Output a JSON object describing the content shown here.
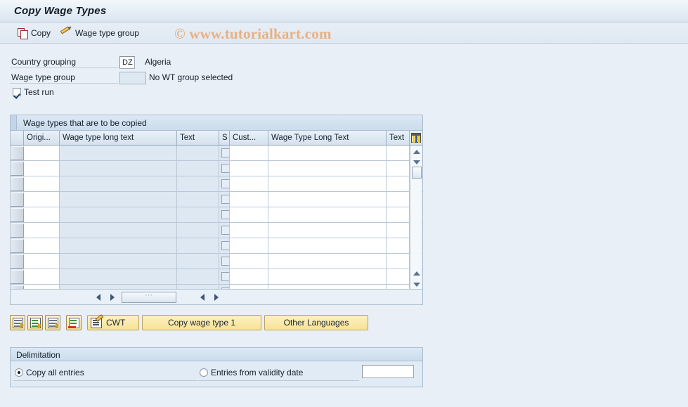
{
  "window": {
    "title": "Copy Wage Types"
  },
  "watermark": {
    "text": "© www.tutorialkart.com"
  },
  "toolbar": {
    "copy_label": "Copy",
    "wage_type_group_label": "Wage type group"
  },
  "form": {
    "country_grouping_label": "Country grouping",
    "country_grouping_value": "DZ",
    "country_grouping_desc": "Algeria",
    "wage_type_group_label": "Wage type group",
    "wage_type_group_value": "",
    "wage_type_group_desc": "No WT group selected",
    "test_run_label": "Test run",
    "test_run_checked": true
  },
  "table": {
    "title": "Wage types that are to be copied",
    "columns": [
      {
        "label": "",
        "kind": "selector"
      },
      {
        "label": "Origi...",
        "kind": "edit"
      },
      {
        "label": "Wage type long text",
        "kind": "readonly"
      },
      {
        "label": "Text",
        "kind": "readonly"
      },
      {
        "label": "S",
        "kind": "checkbox"
      },
      {
        "label": "Cust...",
        "kind": "edit"
      },
      {
        "label": "Wage Type Long Text",
        "kind": "edit"
      },
      {
        "label": "Text",
        "kind": "edit"
      }
    ],
    "config_icon": "table-settings-icon",
    "row_count": 10,
    "rows": [
      {
        "origin": "",
        "wage_type_long_text": "",
        "text": "",
        "s": false,
        "cust": "",
        "wage_type_long_text_2": "",
        "text_2": ""
      },
      {
        "origin": "",
        "wage_type_long_text": "",
        "text": "",
        "s": false,
        "cust": "",
        "wage_type_long_text_2": "",
        "text_2": ""
      },
      {
        "origin": "",
        "wage_type_long_text": "",
        "text": "",
        "s": false,
        "cust": "",
        "wage_type_long_text_2": "",
        "text_2": ""
      },
      {
        "origin": "",
        "wage_type_long_text": "",
        "text": "",
        "s": false,
        "cust": "",
        "wage_type_long_text_2": "",
        "text_2": ""
      },
      {
        "origin": "",
        "wage_type_long_text": "",
        "text": "",
        "s": false,
        "cust": "",
        "wage_type_long_text_2": "",
        "text_2": ""
      },
      {
        "origin": "",
        "wage_type_long_text": "",
        "text": "",
        "s": false,
        "cust": "",
        "wage_type_long_text_2": "",
        "text_2": ""
      },
      {
        "origin": "",
        "wage_type_long_text": "",
        "text": "",
        "s": false,
        "cust": "",
        "wage_type_long_text_2": "",
        "text_2": ""
      },
      {
        "origin": "",
        "wage_type_long_text": "",
        "text": "",
        "s": false,
        "cust": "",
        "wage_type_long_text_2": "",
        "text_2": ""
      },
      {
        "origin": "",
        "wage_type_long_text": "",
        "text": "",
        "s": false,
        "cust": "",
        "wage_type_long_text_2": "",
        "text_2": ""
      },
      {
        "origin": "",
        "wage_type_long_text": "",
        "text": "",
        "s": false,
        "cust": "",
        "wage_type_long_text_2": "",
        "text_2": ""
      }
    ]
  },
  "actions": {
    "icon_buttons": [
      {
        "name": "insert-row-icon"
      },
      {
        "name": "copy-row-icon"
      },
      {
        "name": "duplicate-row-icon"
      },
      {
        "name": "delete-row-icon"
      }
    ],
    "cwt_label": "CWT",
    "copy_wage_type_label": "Copy wage type 1",
    "other_languages_label": "Other Languages"
  },
  "delimitation": {
    "title": "Delimitation",
    "copy_all_label": "Copy all entries",
    "copy_all_selected": true,
    "entries_from_date_label": "Entries from validity date",
    "entries_from_date_selected": false,
    "validity_date_value": ""
  },
  "colors": {
    "page_background": "#e9eff6",
    "accent_button": "#f7e294",
    "watermark": "#e7b183",
    "readonly_cell": "#dde8f3"
  }
}
